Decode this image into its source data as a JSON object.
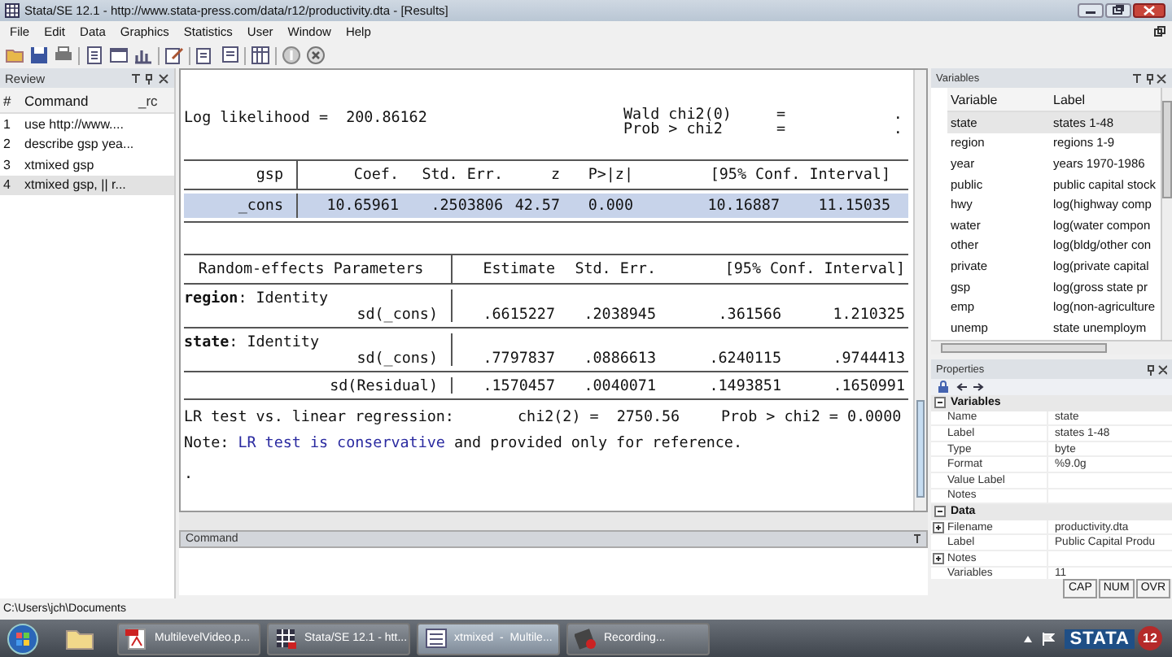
{
  "window": {
    "title": "Stata/SE 12.1 - http://www.stata-press.com/data/r12/productivity.dta - [Results]"
  },
  "menu": [
    "File",
    "Edit",
    "Data",
    "Graphics",
    "Statistics",
    "User",
    "Window",
    "Help"
  ],
  "review": {
    "title": "Review",
    "columns": [
      "#",
      "Command",
      "_rc"
    ],
    "rows": [
      {
        "num": "1",
        "command": "use http://www....",
        "selected": false
      },
      {
        "num": "2",
        "command": "describe gsp yea...",
        "selected": false
      },
      {
        "num": "3",
        "command": "xtmixed gsp",
        "selected": false
      },
      {
        "num": "4",
        "command": "xtmixed gsp, || r...",
        "selected": true
      }
    ]
  },
  "results": {
    "log_likelihood": {
      "label": "Log likelihood =",
      "value": "200.86162"
    },
    "stats": [
      {
        "label": "Wald chi2(0)",
        "eq": "=",
        "value": "."
      },
      {
        "label": "Prob > chi2",
        "eq": "=",
        "value": "."
      }
    ],
    "fixed_table": {
      "columns": [
        "gsp",
        "Coef.",
        "Std. Err.",
        "z",
        "P>|z|",
        "[95% Conf. Interval]"
      ],
      "rows": [
        {
          "cells": [
            "_cons",
            "10.65961",
            ".2503806",
            "42.57",
            "0.000",
            "10.16887",
            "11.15035"
          ],
          "selected": true
        }
      ]
    },
    "random_table": {
      "columns": [
        "Random-effects Parameters",
        "Estimate",
        "Std. Err.",
        "[95% Conf. Interval]"
      ],
      "groups": [
        {
          "heading": "**region**: Identity",
          "rows": [
            {
              "cells": [
                "sd(_cons)",
                ".6615227",
                ".2038945",
                ".361566",
                "1.210325"
              ]
            }
          ]
        },
        {
          "heading": "**state**: Identity",
          "rows": [
            {
              "cells": [
                "sd(_cons)",
                ".7797837",
                ".0886613",
                ".6240115",
                ".9744413"
              ]
            }
          ]
        },
        {
          "rows": [
            {
              "cells": [
                "sd(Residual)",
                ".1570457",
                ".0040071",
                ".1493851",
                ".1650991"
              ]
            }
          ]
        }
      ]
    },
    "lr_test": {
      "label": "LR test vs. linear regression:",
      "chi_label": "chi2(2) =",
      "chi_value": "2750.56",
      "prob_label": "Prob > chi2 =",
      "prob_value": "0.0000"
    },
    "note": {
      "label": "Note:",
      "link": "LR test is conservative",
      "rest": "and provided only for reference."
    },
    "prompt": "."
  },
  "command": {
    "title": "Command"
  },
  "variables": {
    "title": "Variables",
    "columns": [
      "Variable",
      "Label"
    ],
    "rows": [
      {
        "name": "state",
        "label": "states 1-48",
        "selected": true
      },
      {
        "name": "region",
        "label": "regions 1-9",
        "selected": false
      },
      {
        "name": "year",
        "label": "years 1970-1986",
        "selected": false
      },
      {
        "name": "public",
        "label": "public capital stock",
        "selected": false
      },
      {
        "name": "hwy",
        "label": "log(highway comp",
        "selected": false
      },
      {
        "name": "water",
        "label": "log(water compon",
        "selected": false
      },
      {
        "name": "other",
        "label": "log(bldg/other con",
        "selected": false
      },
      {
        "name": "private",
        "label": "log(private capital",
        "selected": false
      },
      {
        "name": "gsp",
        "label": "log(gross state pr",
        "selected": false
      },
      {
        "name": "emp",
        "label": "log(non-agriculture",
        "selected": false
      },
      {
        "name": "unemp",
        "label": "state unemploym",
        "selected": false
      }
    ]
  },
  "properties": {
    "title": "Properties",
    "sections": [
      {
        "title": "Variables",
        "expanded": true,
        "rows": [
          {
            "kind": "plain",
            "key": "Name",
            "value": "state"
          },
          {
            "kind": "plain",
            "key": "Label",
            "value": "states 1-48"
          },
          {
            "kind": "plain",
            "key": "Type",
            "value": "byte"
          },
          {
            "kind": "plain",
            "key": "Format",
            "value": "%9.0g"
          },
          {
            "kind": "plain",
            "key": "Value Label"
          },
          {
            "kind": "plain",
            "key": "Notes"
          }
        ]
      },
      {
        "title": "Data",
        "expanded": true,
        "rows": [
          {
            "kind": "expandable",
            "key": "Filename",
            "value": "productivity.dta"
          },
          {
            "kind": "plain",
            "key": "Label",
            "value": "Public Capital Produ"
          },
          {
            "kind": "expandable",
            "key": "Notes"
          },
          {
            "kind": "plain",
            "key": "Variables",
            "value": "11"
          }
        ]
      }
    ]
  },
  "indicators": [
    "CAP",
    "NUM",
    "OVR"
  ],
  "status_bar": {
    "path": "C:\\Users\\jch\\Documents"
  },
  "taskbar": {
    "tasks": [
      {
        "kind": "pdf",
        "label": "MultilevelVideo.p...",
        "selected": false
      },
      {
        "kind": "stata",
        "label": "Stata/SE 12.1 - htt...",
        "selected": false
      },
      {
        "kind": "doc",
        "label": "xtmixed  -  Multile...",
        "selected": true
      },
      {
        "kind": "record",
        "label": "Recording...",
        "selected": false
      }
    ],
    "tray_logo": {
      "name": "STATA",
      "version": "12"
    }
  }
}
